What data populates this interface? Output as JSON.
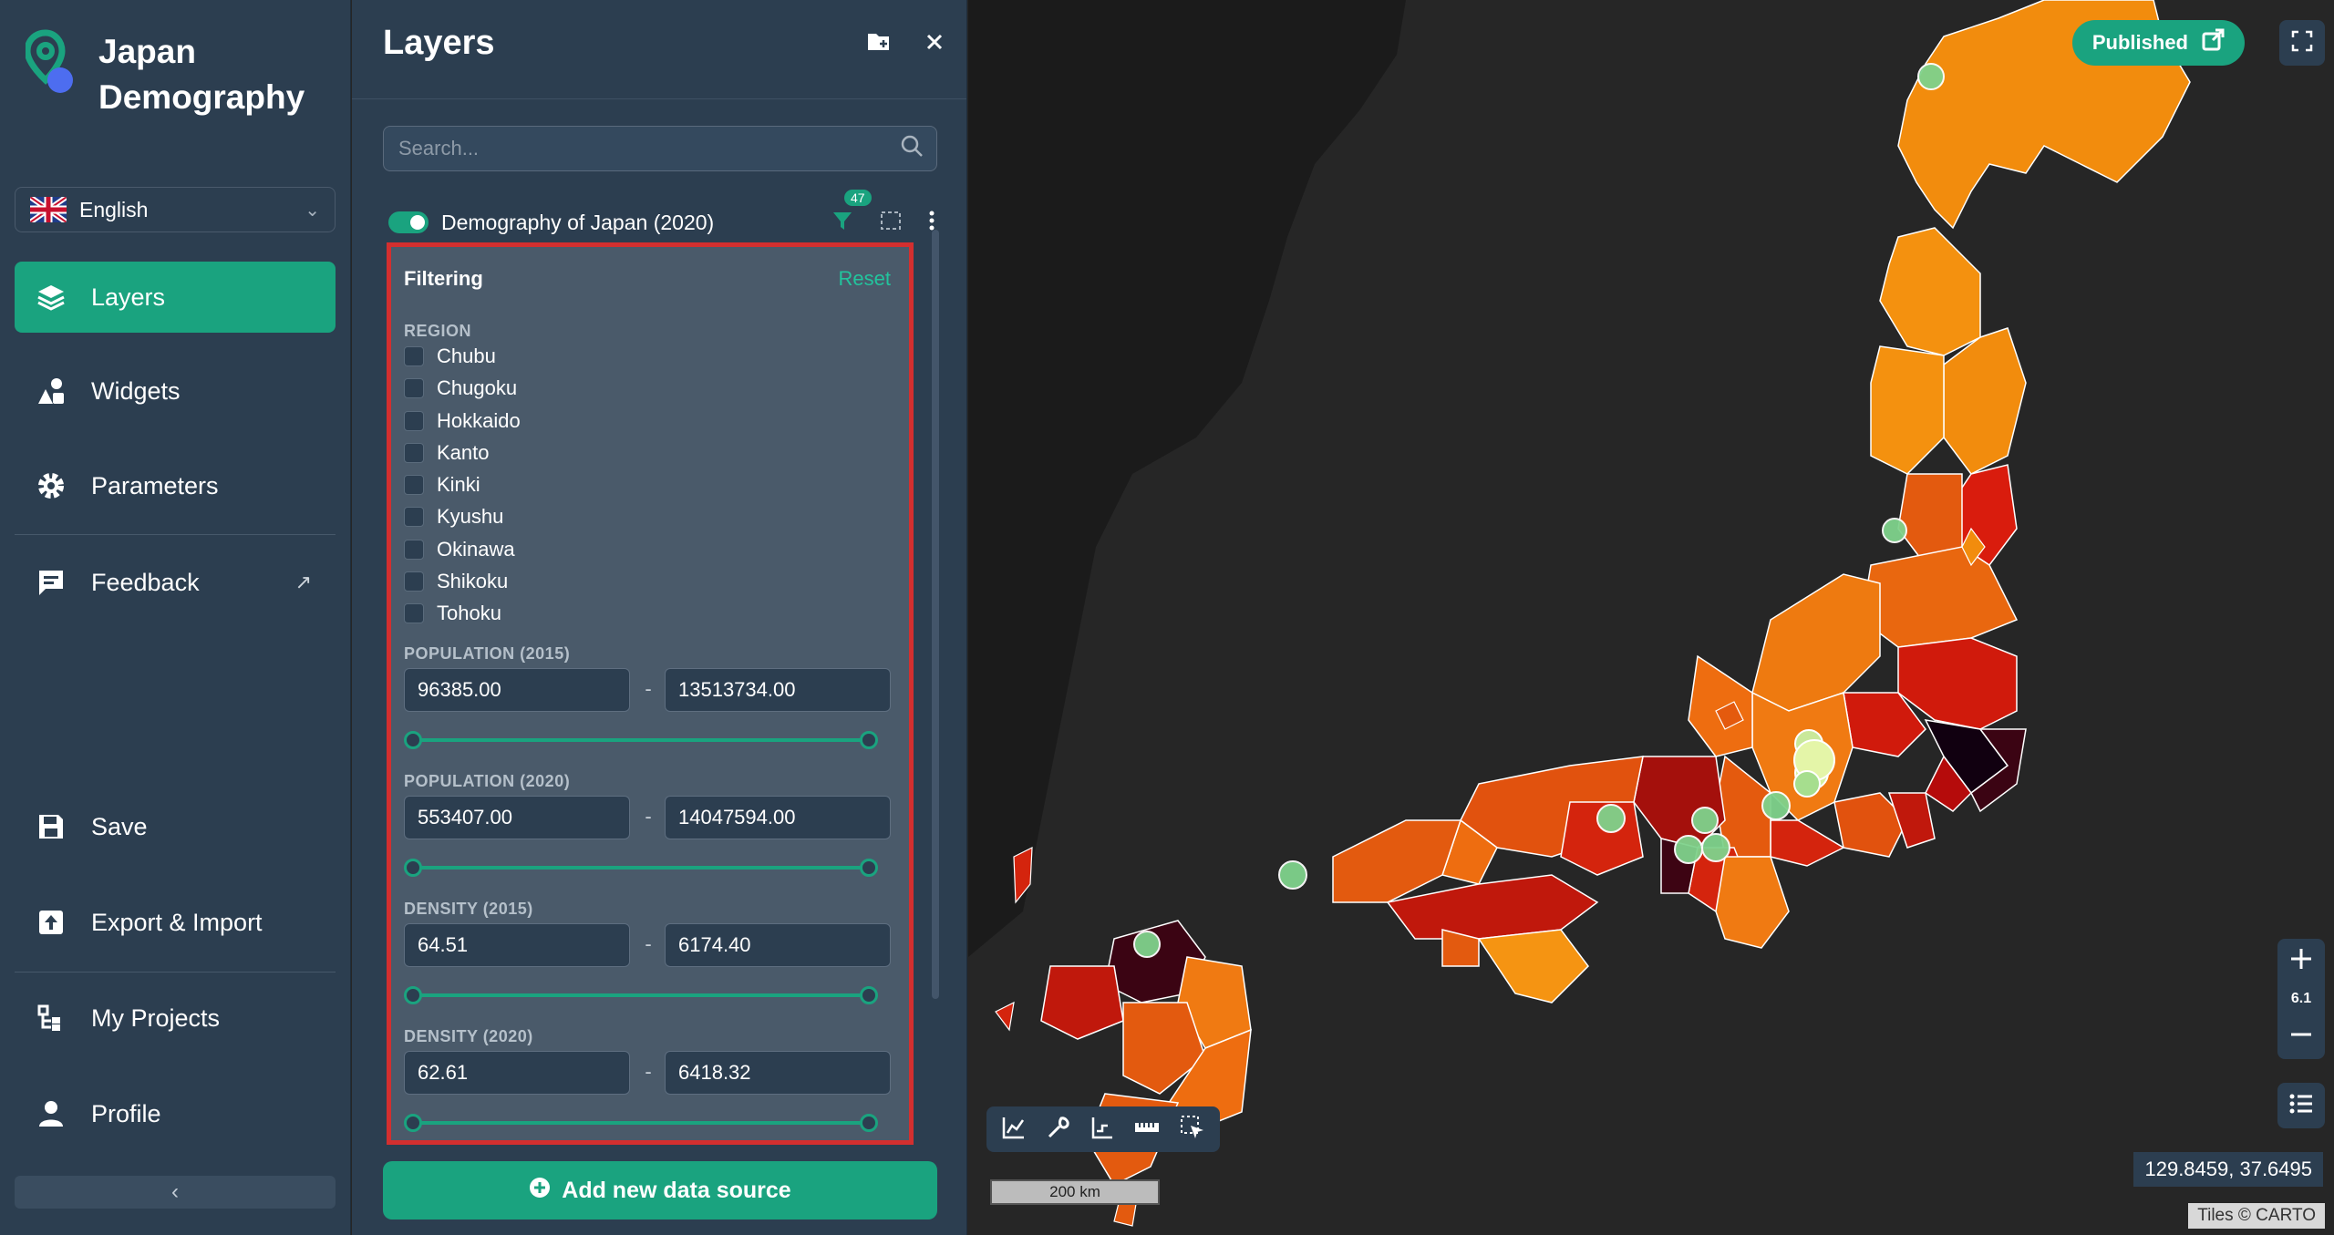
{
  "app": {
    "title": "Japan Demography"
  },
  "language": {
    "label": "English"
  },
  "nav": {
    "layers": "Layers",
    "widgets": "Widgets",
    "parameters": "Parameters",
    "feedback": "Feedback",
    "save": "Save",
    "export_import": "Export & Import",
    "my_projects": "My Projects",
    "profile": "Profile"
  },
  "layers_panel": {
    "title": "Layers",
    "search_placeholder": "Search...",
    "layer": {
      "name": "Demography of Japan (2020)",
      "filter_count": "47"
    },
    "filtering": {
      "title": "Filtering",
      "reset": "Reset",
      "region_label": "REGION",
      "regions": [
        "Chubu",
        "Chugoku",
        "Hokkaido",
        "Kanto",
        "Kinki",
        "Kyushu",
        "Okinawa",
        "Shikoku",
        "Tohoku"
      ],
      "ranges": [
        {
          "label": "POPULATION (2015)",
          "min": "96385.00",
          "max": "13513734.00"
        },
        {
          "label": "POPULATION (2020)",
          "min": "553407.00",
          "max": "14047594.00"
        },
        {
          "label": "DENSITY (2015)",
          "min": "64.51",
          "max": "6174.40"
        },
        {
          "label": "DENSITY (2020)",
          "min": "62.61",
          "max": "6418.32"
        }
      ]
    },
    "add_button": "Add new data source"
  },
  "map": {
    "published_label": "Published",
    "zoom_level": "6.1",
    "scale_label": "200 km",
    "coordinates": "129.8459, 37.6495",
    "attribution": "Tiles © CARTO"
  },
  "colors": {
    "accent": "#1aa37f",
    "panel": "#2c3e50",
    "filter_outline": "#d32f2f"
  }
}
